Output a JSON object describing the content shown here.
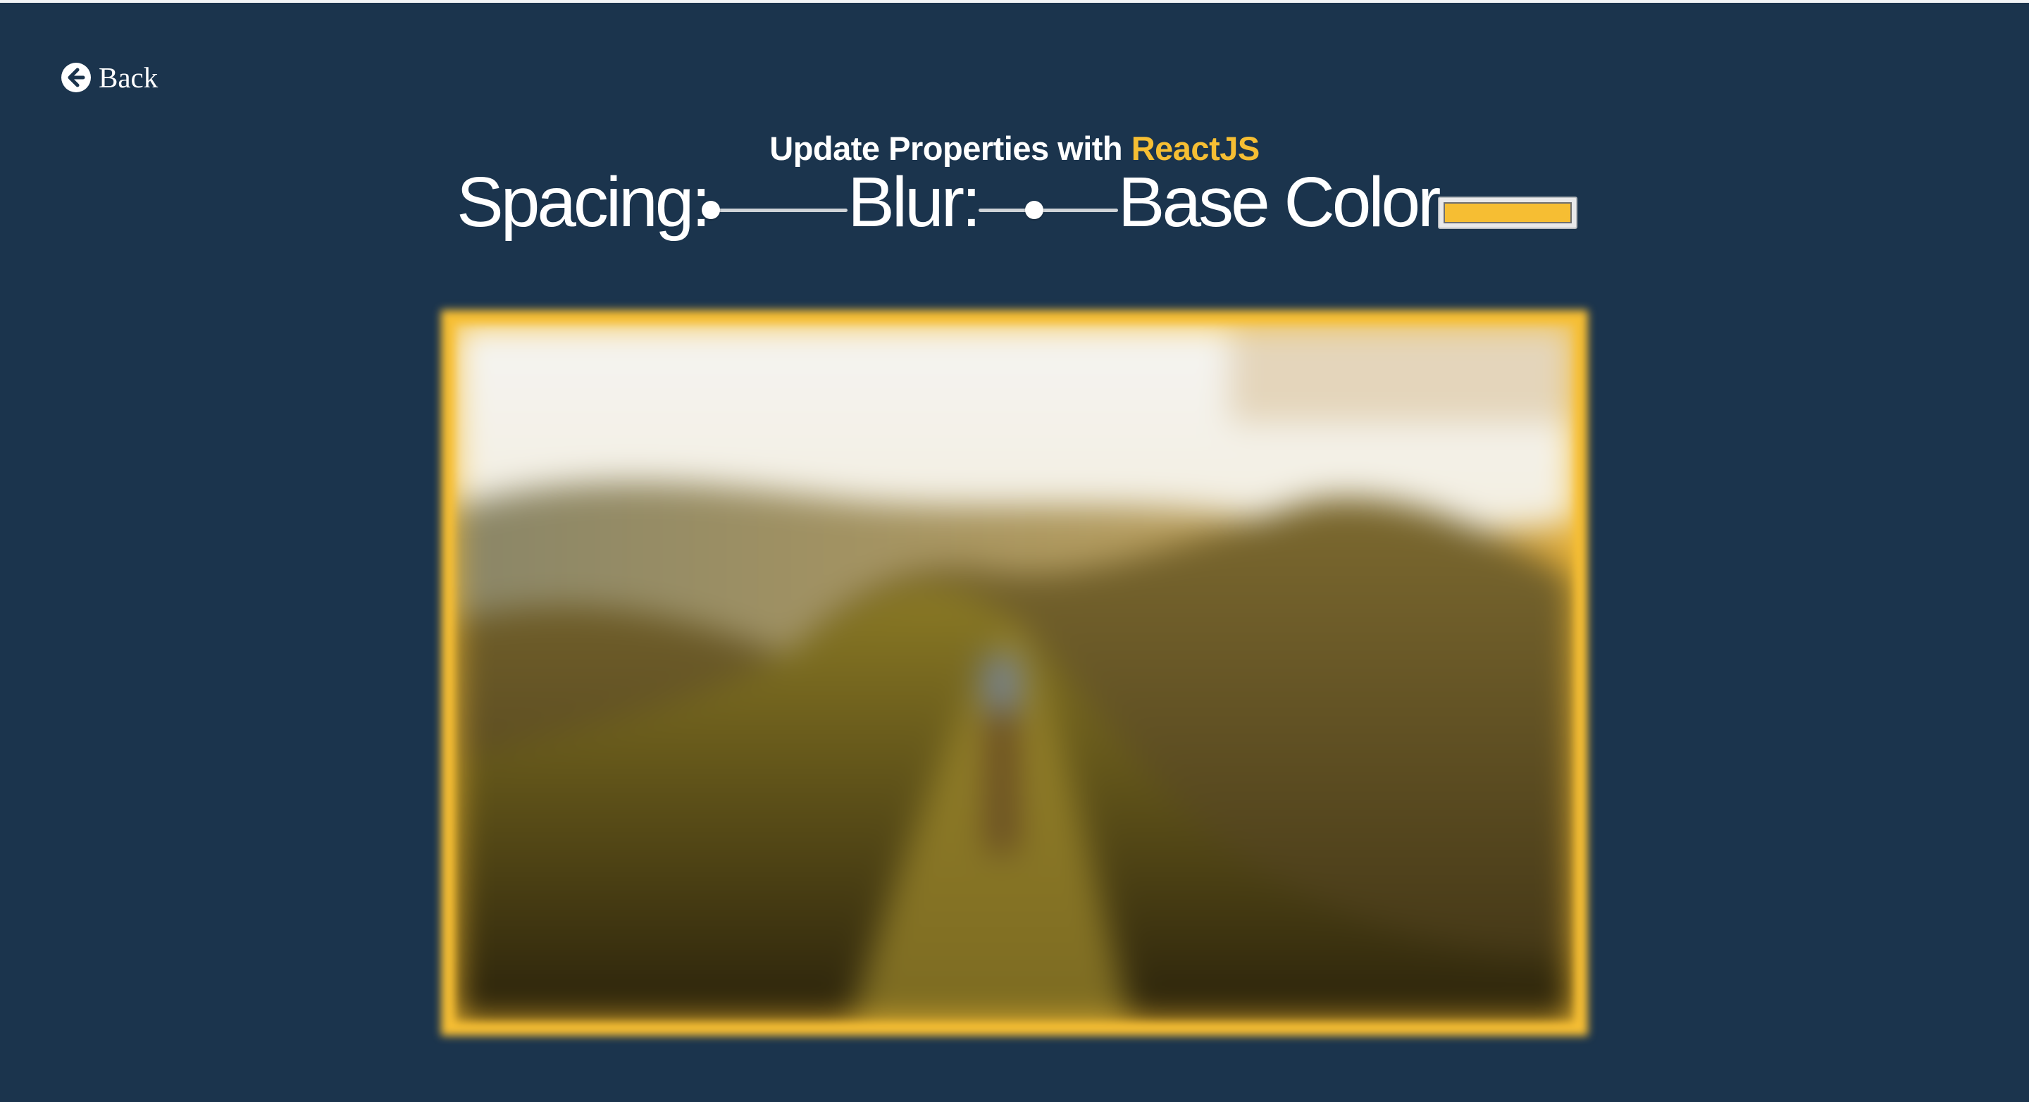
{
  "nav": {
    "back_label": "Back"
  },
  "header": {
    "title_prefix": "Update Properties with ",
    "title_accent": "ReactJS"
  },
  "controls": {
    "spacing": {
      "label": "Spacing:",
      "value_fraction": 0.02
    },
    "blur": {
      "label": "Blur:",
      "value_fraction": 0.4
    },
    "base_color": {
      "label": "Base Color",
      "value": "#f6be33"
    }
  },
  "colors": {
    "background": "#1b344d",
    "accent": "#f6be33",
    "text": "#ffffff"
  },
  "image": {
    "icon": "landscape-photo-icon"
  }
}
